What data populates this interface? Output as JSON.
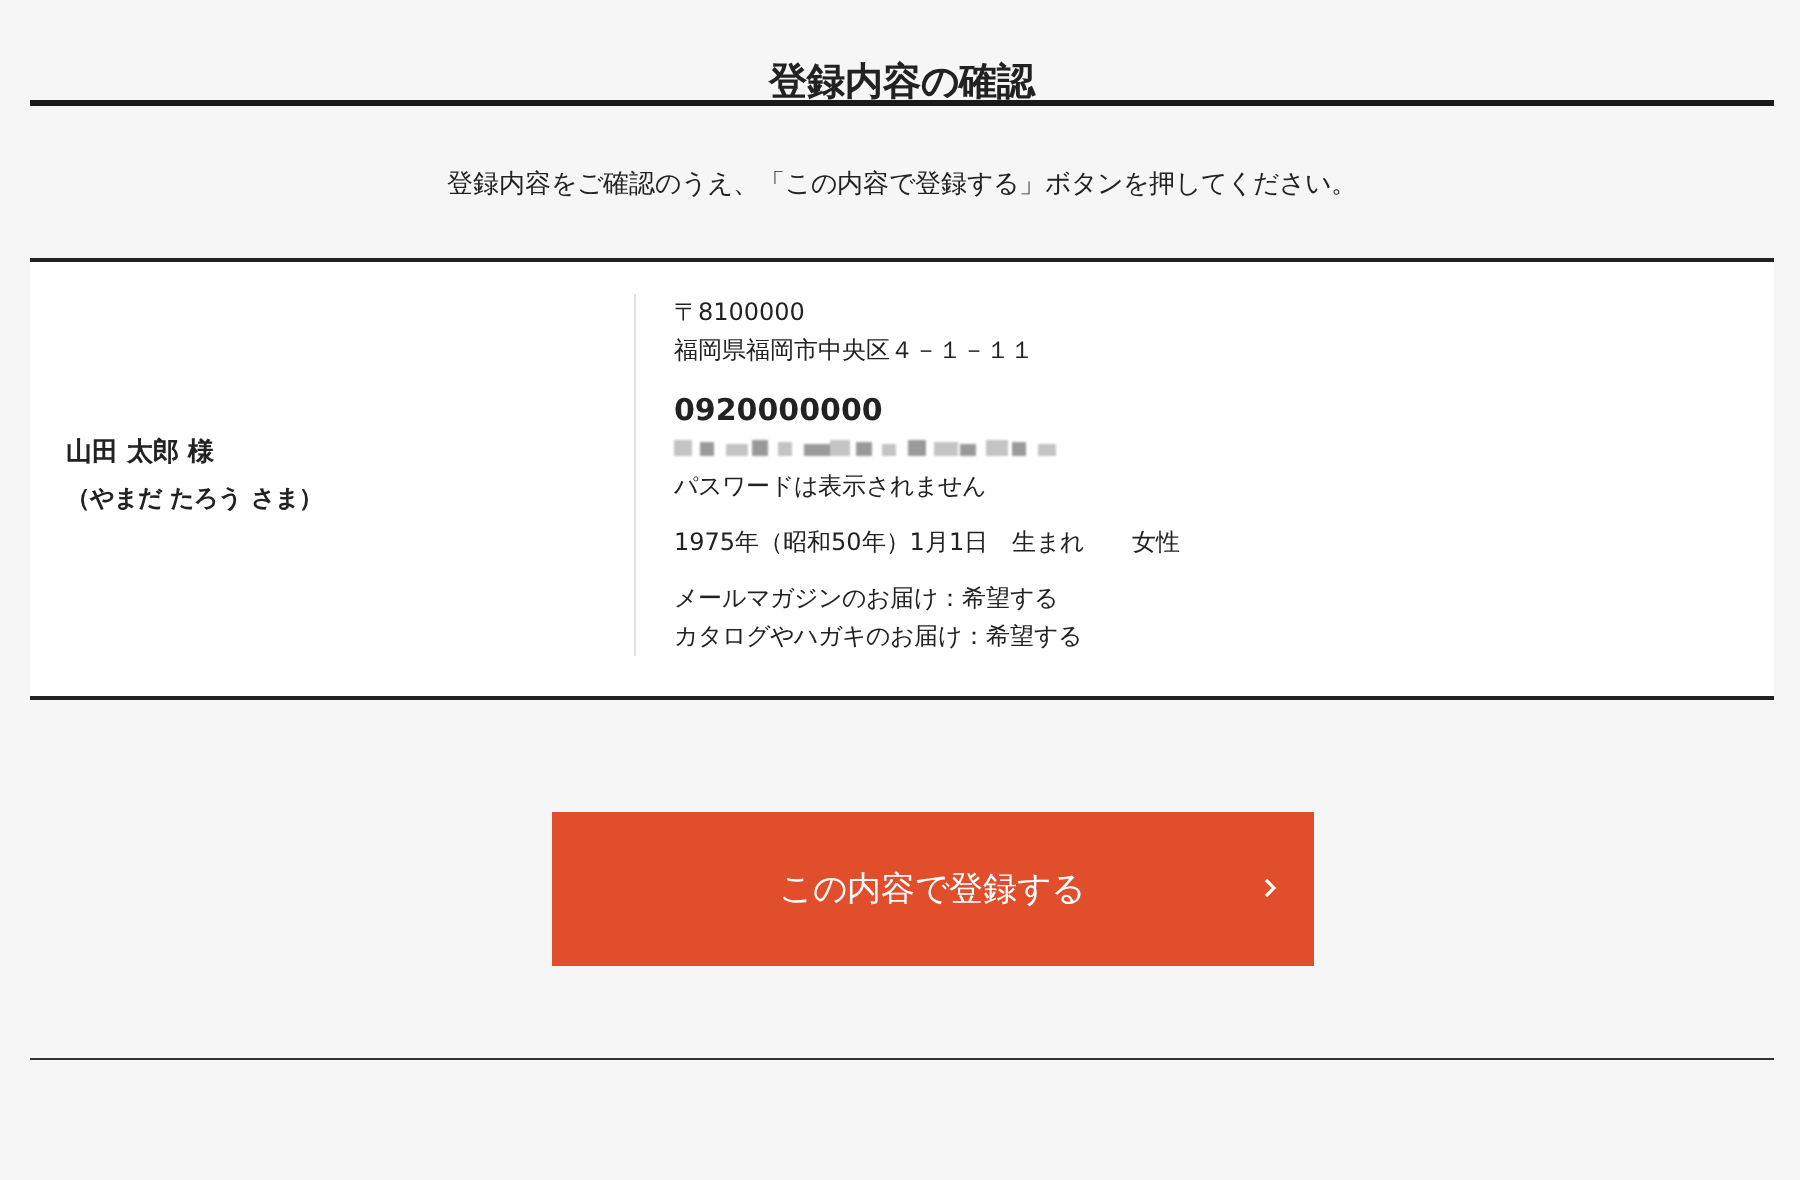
{
  "page_title": "登録内容の確認",
  "instruction": "登録内容をご確認のうえ、「この内容で登録する」ボタンを押してください。",
  "customer": {
    "name": "山田 太郎 様",
    "reading": "（やまだ たろう さま）"
  },
  "details": {
    "postal_code": "〒8100000",
    "address": "福岡県福岡市中央区４－１－１１",
    "phone": "0920000000",
    "password_note": "パスワードは表示されません",
    "birth": "1975年（昭和50年）1月1日　生まれ",
    "gender": "女性",
    "preferences": [
      "メールマガジンのお届け：希望する",
      "カタログやハガキのお届け：希望する"
    ]
  },
  "submit_button": {
    "label": "この内容で登録する"
  }
}
